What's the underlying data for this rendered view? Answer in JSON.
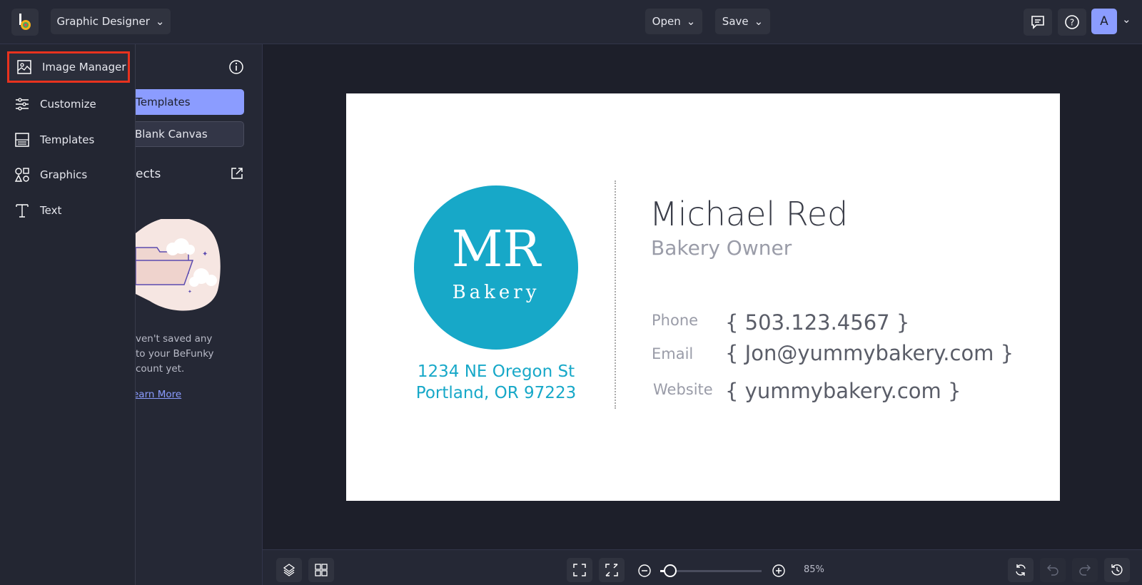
{
  "header": {
    "workspace": "Graphic Designer",
    "open": "Open",
    "save": "Save",
    "avatar": "A"
  },
  "menu": [
    {
      "label": "Image Manager",
      "icon": "image-icon"
    },
    {
      "label": "Customize",
      "icon": "sliders-icon"
    },
    {
      "label": "Templates",
      "icon": "templates-icon"
    },
    {
      "label": "Graphics",
      "icon": "shapes-icon"
    },
    {
      "label": "Text",
      "icon": "text-icon"
    }
  ],
  "panel": {
    "primary_button": "h Templates",
    "secondary_button": "a Blank Canvas",
    "section": "ects",
    "empty_text": [
      "ven't saved any",
      "to your BeFunky",
      "count yet."
    ],
    "learn_more": "earn More"
  },
  "card": {
    "logo_initials": "MR",
    "logo_sub": "Bakery",
    "address1": "1234 NE Oregon St",
    "address2": "Portland, OR 97223",
    "name": "Michael Red",
    "title": "Bakery Owner",
    "fields": [
      {
        "label": "Phone",
        "value": "{ 503.123.4567 }"
      },
      {
        "label": "Email",
        "value": "{ Jon@yummybakery.com }"
      },
      {
        "label": "Website",
        "value": "{ yummybakery.com }"
      }
    ],
    "accent": "#17a8c8"
  },
  "zoom": {
    "level_label": "85%",
    "level": 85
  },
  "colors": {
    "highlight": "#e8321e",
    "primary": "#8b9cff"
  }
}
